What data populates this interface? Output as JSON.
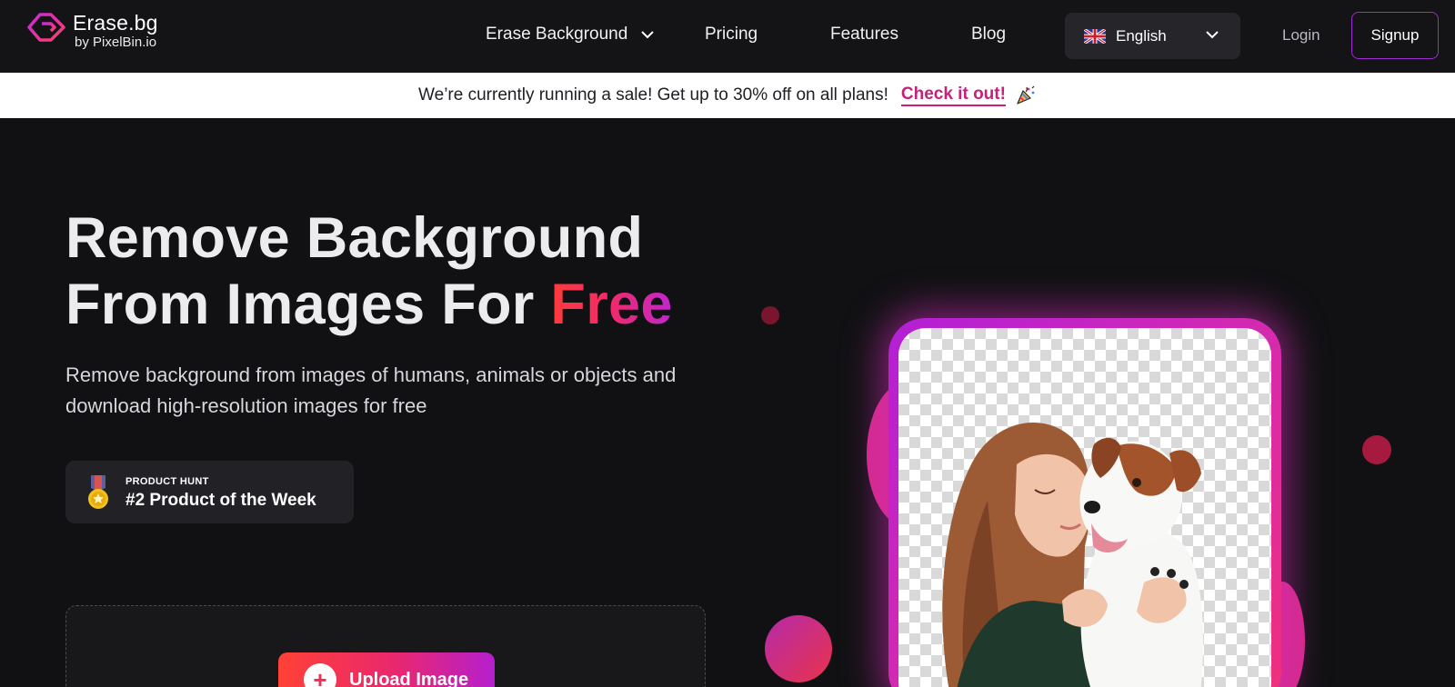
{
  "brand": {
    "name": "Erase.bg",
    "byline": "by PixelBin.io"
  },
  "nav": {
    "items": [
      {
        "label": "Erase Background",
        "has_dropdown": true
      },
      {
        "label": "Pricing",
        "has_dropdown": false
      },
      {
        "label": "Features",
        "has_dropdown": false
      },
      {
        "label": "Blog",
        "has_dropdown": false
      }
    ],
    "language": {
      "selected": "English",
      "flag_icon": "uk-flag-icon"
    },
    "login_label": "Login",
    "signup_label": "Signup"
  },
  "banner": {
    "text": "We’re currently running a sale! Get up to 30% off on all plans!",
    "cta": "Check it out!",
    "icon": "party-popper-icon"
  },
  "hero": {
    "title_line1": "Remove Background",
    "title_line2_prefix": "From Images For ",
    "title_highlight": "Free",
    "subtitle": "Remove background from images of humans, animals or objects and download high-resolution images for free",
    "badge": {
      "small": "PRODUCT HUNT",
      "big": "#2 Product of the Week",
      "icon": "medal-icon"
    },
    "upload_label": "Upload Image"
  },
  "colors": {
    "accent_red": "#ff3b3b",
    "accent_pink": "#e8276f",
    "accent_purple": "#b51fcf",
    "page_bg": "#111113"
  }
}
